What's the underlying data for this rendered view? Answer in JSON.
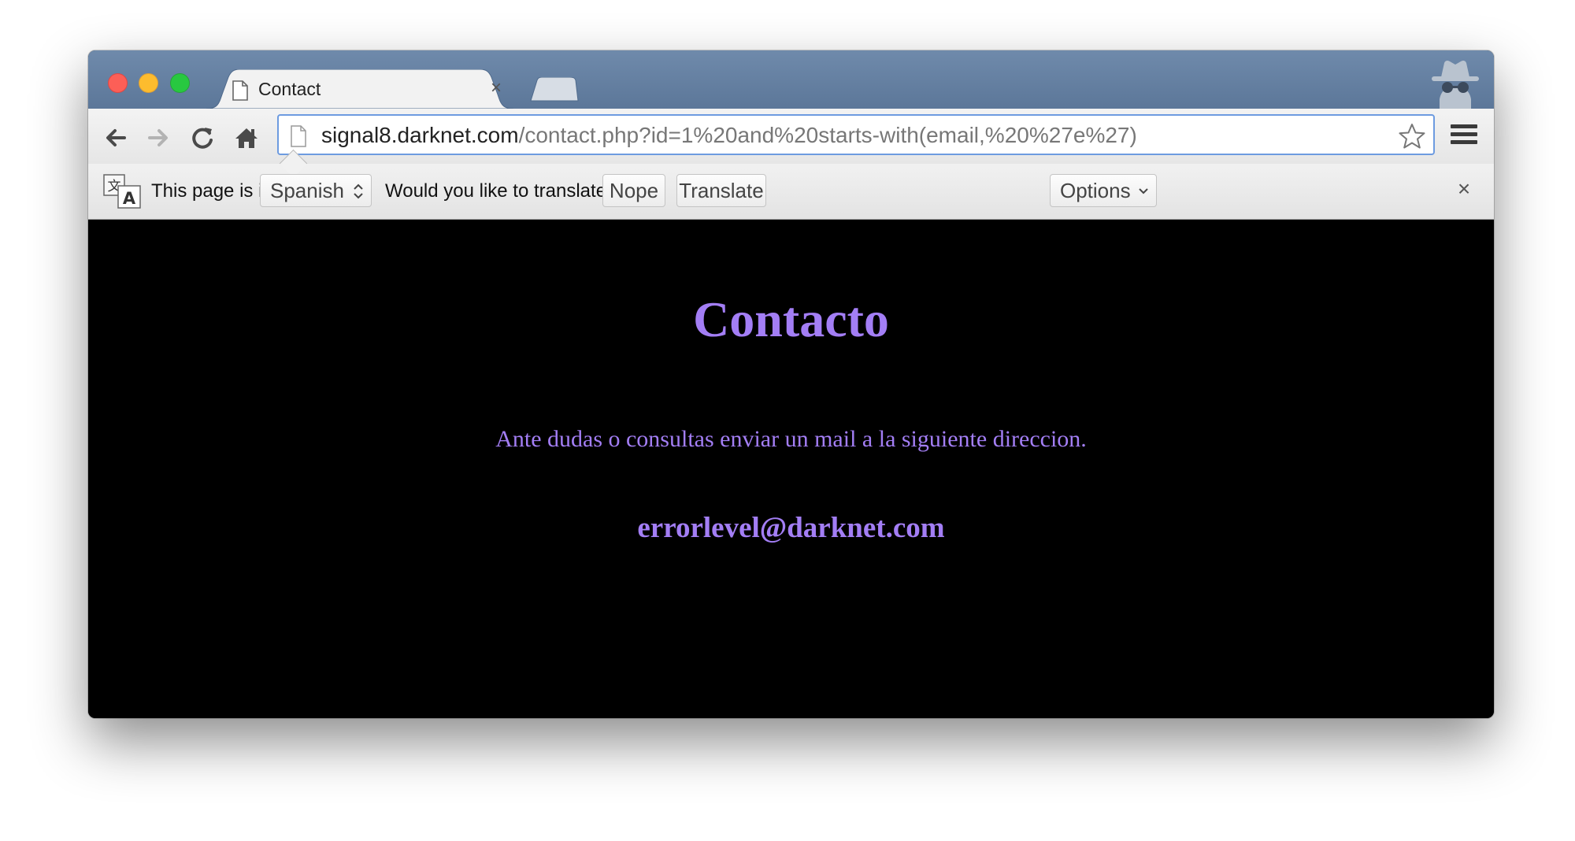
{
  "browser": {
    "tab": {
      "title": "Contact"
    },
    "address_bar": {
      "host": "signal8.darknet.com",
      "path": "/contact.php?id=1%20and%20starts-with(email,%20%27e%27)"
    },
    "mode_icon": "incognito-icon"
  },
  "translate_bar": {
    "prefix": "This page is in",
    "language": "Spanish",
    "question": "Would you like to translate it?",
    "nope_label": "Nope",
    "translate_label": "Translate",
    "options_label": "Options",
    "close_label": "×"
  },
  "page": {
    "heading": "Contacto",
    "text": "Ante dudas o consultas enviar un mail a la siguiente direccion.",
    "email": "errorlevel@darknet.com"
  },
  "colors": {
    "page_background": "#000000",
    "page_text": "#a37ef5",
    "titlebar": "#5c7799",
    "omnibox_focus": "#6d9be0"
  }
}
